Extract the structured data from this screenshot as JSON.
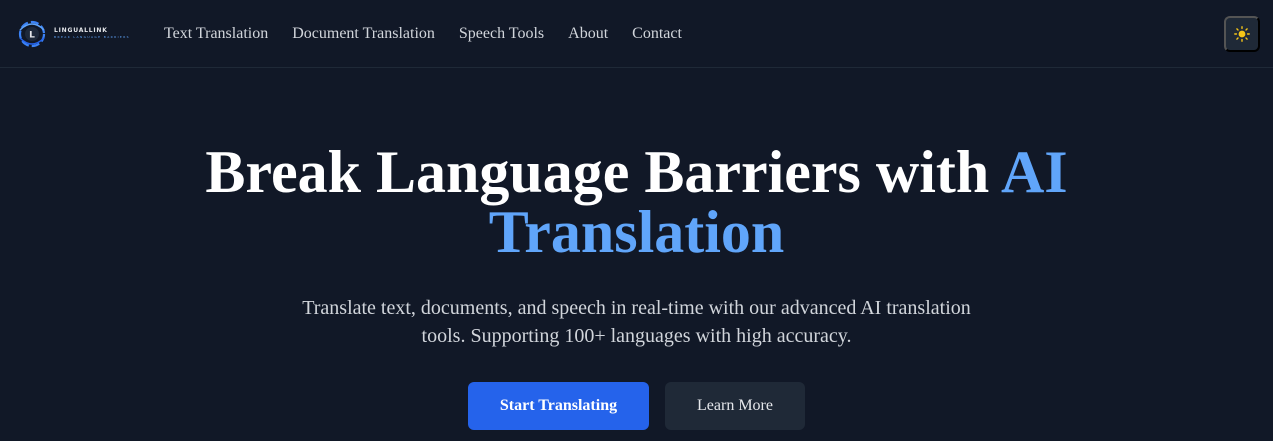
{
  "brand": {
    "name": "LINGUALLINK",
    "tagline": "BREAK LANGUAGE BARRIERS",
    "monogram": "L"
  },
  "nav": {
    "links": [
      {
        "label": "Text Translation"
      },
      {
        "label": "Document Translation"
      },
      {
        "label": "Speech Tools"
      },
      {
        "label": "About"
      },
      {
        "label": "Contact"
      }
    ],
    "theme_toggle_icon": "sun-icon"
  },
  "hero": {
    "title_main": "Break Language Barriers with ",
    "title_accent": "AI Translation",
    "subtitle": "Translate text, documents, and speech in real-time with our advanced AI translation tools. Supporting 100+ languages with high accuracy.",
    "primary_cta": "Start Translating",
    "secondary_cta": "Learn More"
  },
  "colors": {
    "background": "#111827",
    "accent": "#60a5fa",
    "primary_button": "#2563eb",
    "surface": "#1f2937",
    "sun": "#f5c518"
  }
}
